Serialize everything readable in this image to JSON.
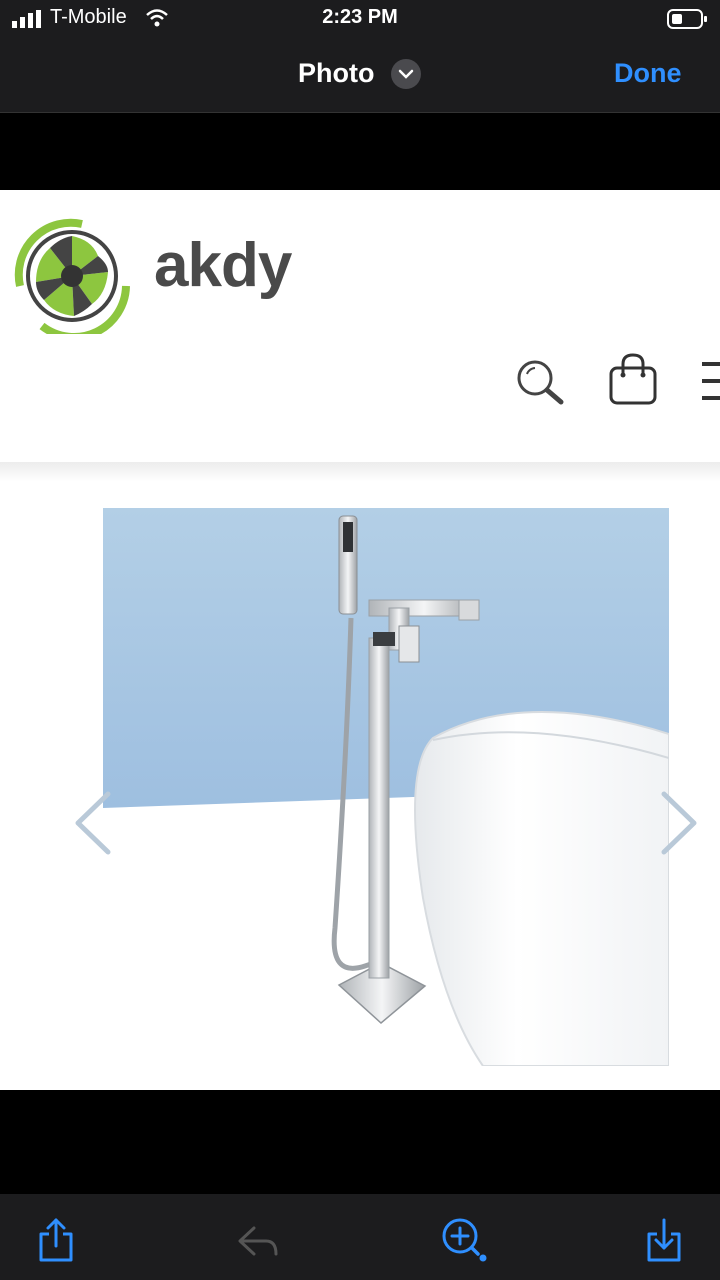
{
  "status_bar": {
    "carrier": "T-Mobile",
    "time": "2:23 PM"
  },
  "nav": {
    "title": "Photo",
    "done_label": "Done"
  },
  "site": {
    "brand": "akdy"
  },
  "colors": {
    "accent": "#2f8fff",
    "logo_green": "#8dc63f",
    "sky": "#a9c8e4"
  },
  "icons": {
    "share": "share-icon",
    "markup": "markup-icon",
    "zoom": "zoom-icon",
    "save": "save-icon"
  }
}
